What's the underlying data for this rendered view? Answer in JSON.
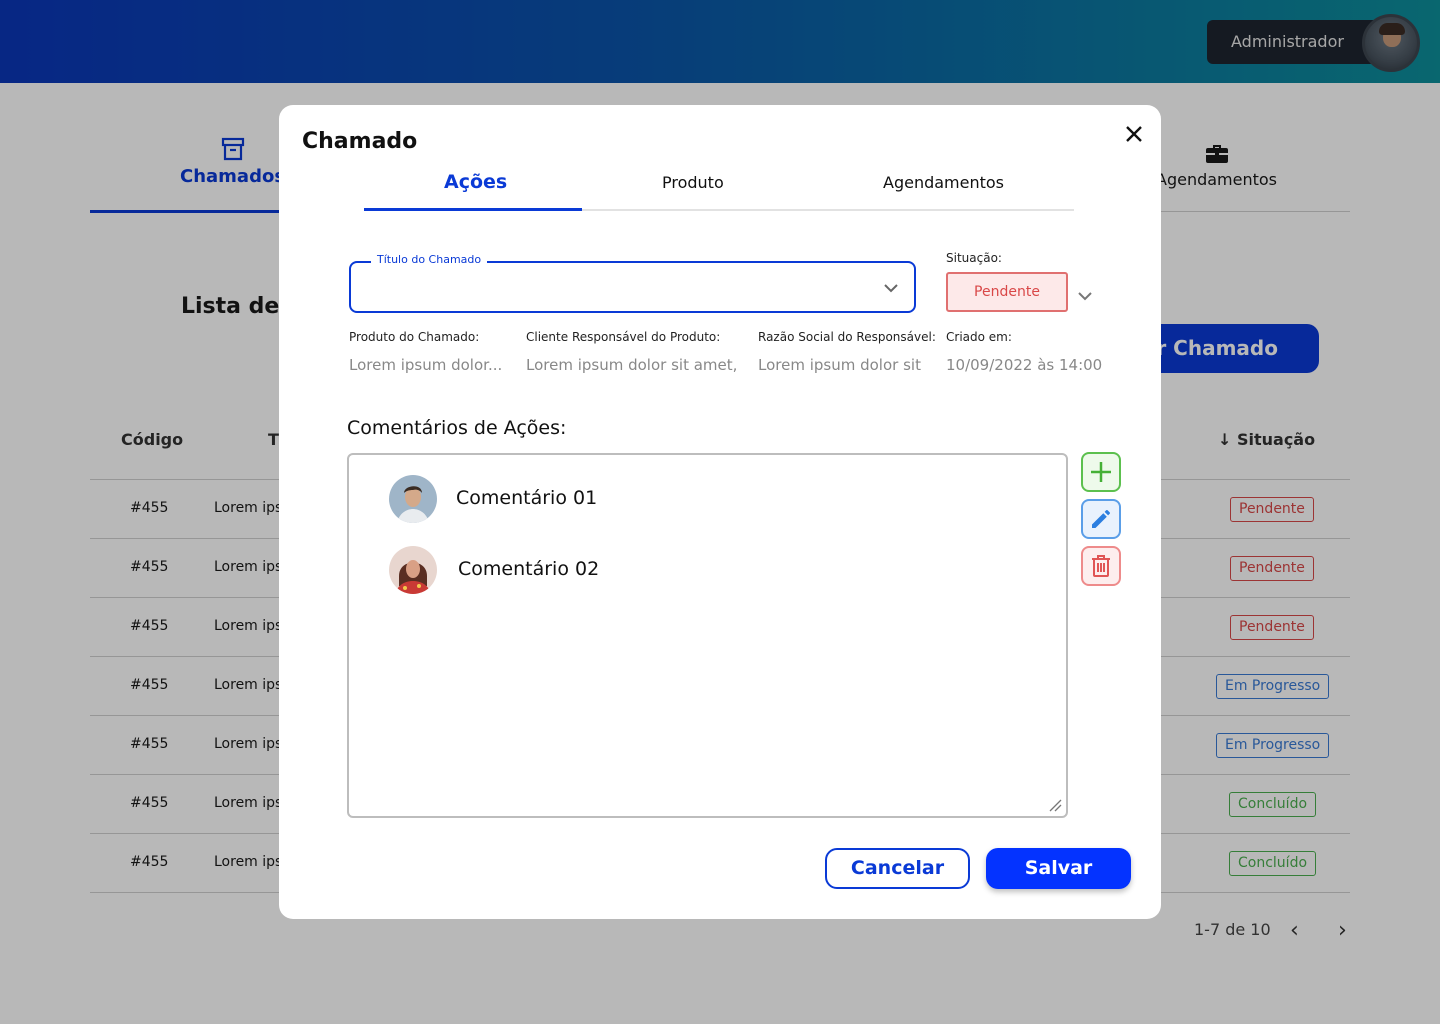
{
  "header": {
    "user_name": "Administrador"
  },
  "page": {
    "tabs": [
      {
        "label": "Chamados",
        "icon": "archive-icon",
        "active": true
      },
      {
        "label": "Agendamentos",
        "icon": "briefcase-icon",
        "active": false
      }
    ],
    "list_title": "Lista de A",
    "create_button": "iar Chamado",
    "table": {
      "headers": {
        "code": "Código",
        "title": "T",
        "status": "↓ Situação"
      },
      "rows": [
        {
          "code": "#455",
          "title": "Lorem ipsu",
          "status": "Pendente"
        },
        {
          "code": "#455",
          "title": "Lorem ipsu",
          "status": "Pendente"
        },
        {
          "code": "#455",
          "title": "Lorem ipsu",
          "status": "Pendente"
        },
        {
          "code": "#455",
          "title": "Lorem ipsu",
          "status": "Em Progresso"
        },
        {
          "code": "#455",
          "title": "Lorem ipsu",
          "status": "Em Progresso"
        },
        {
          "code": "#455",
          "title": "Lorem ipsu",
          "status": "Concluído"
        },
        {
          "code": "#455",
          "title": "Lorem ipsu",
          "status": "Concluído"
        }
      ]
    },
    "pagination": {
      "text": "1-7 de 10",
      "prev": "‹",
      "next": "›"
    }
  },
  "modal": {
    "title": "Chamado",
    "tabs": [
      "Ações",
      "Produto",
      "Agendamentos"
    ],
    "active_tab": "Ações",
    "title_field_label": "Título do Chamado",
    "status_label": "Situação:",
    "status_value": "Pendente",
    "info": [
      {
        "label": "Produto do Chamado:",
        "value": "Lorem ipsum dolor..."
      },
      {
        "label": "Cliente Responsável do Produto:",
        "value": "Lorem ipsum dolor sit amet,"
      },
      {
        "label": "Razão Social do Responsável:",
        "value": "Lorem ipsum dolor sit"
      },
      {
        "label": "Criado em:",
        "value": "10/09/2022 às 14:00"
      }
    ],
    "comments_title": "Comentários de Ações:",
    "comments": [
      "Comentário 01",
      "Comentário 02"
    ],
    "cancel_label": "Cancelar",
    "save_label": "Salvar"
  },
  "colors": {
    "primary": "#0a3ad6",
    "pending": "#d94848",
    "in_progress": "#3a7bd5",
    "done": "#4caf50"
  }
}
